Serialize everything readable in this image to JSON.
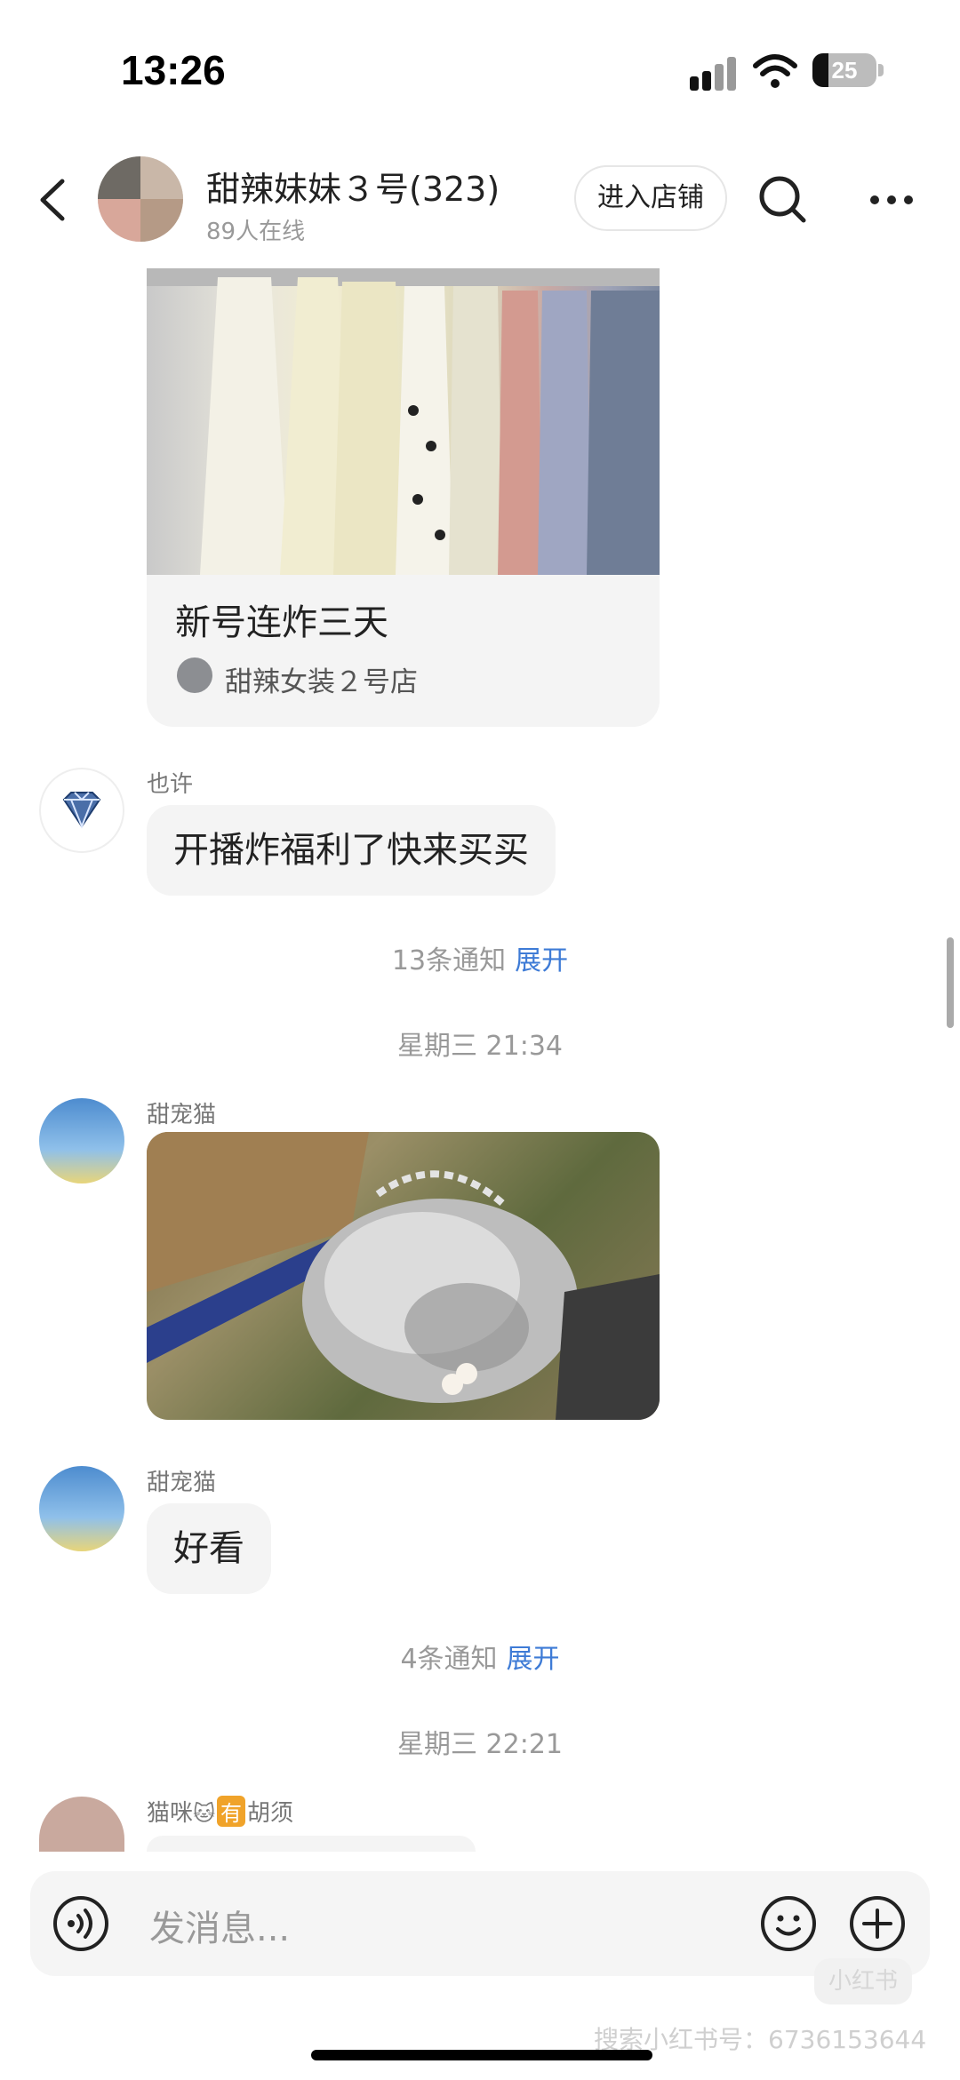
{
  "status_bar": {
    "time": "13:26",
    "battery": "25",
    "battery_level": 0.25
  },
  "header": {
    "title": "甜辣妹妹３号(323)",
    "subtitle": "89人在线",
    "enter_shop": "进入店铺"
  },
  "messages": {
    "card": {
      "title": "新号连炸三天",
      "shop_name": "甜辣女装２号店"
    },
    "msg1": {
      "sender": "也许",
      "text": "开播炸福利了快来买买"
    },
    "notice1": {
      "text": "13条通知",
      "expand": "展开"
    },
    "timestamp1": "星期三 21:34",
    "msg2": {
      "sender": "甜宠猫"
    },
    "msg3": {
      "sender": "甜宠猫",
      "text": "好看"
    },
    "notice2": {
      "text": "4条通知",
      "expand": "展开"
    },
    "timestamp2": "星期三 22:21",
    "msg4": {
      "sender_prefix": "猫咪",
      "sender_badge": "有",
      "sender_suffix": "胡须"
    }
  },
  "input": {
    "placeholder": "发消息..."
  },
  "watermark": {
    "text": "搜索小红书号：6736153644",
    "logo": "小红书"
  },
  "icons": [
    "back-icon",
    "search-icon",
    "more-icon",
    "voice-icon",
    "emoji-icon",
    "plus-icon",
    "diamond-icon",
    "signal-icon",
    "wifi-icon"
  ],
  "colors": {
    "link": "#3e7bd6",
    "bubble": "#f4f4f4",
    "muted": "#999999"
  }
}
